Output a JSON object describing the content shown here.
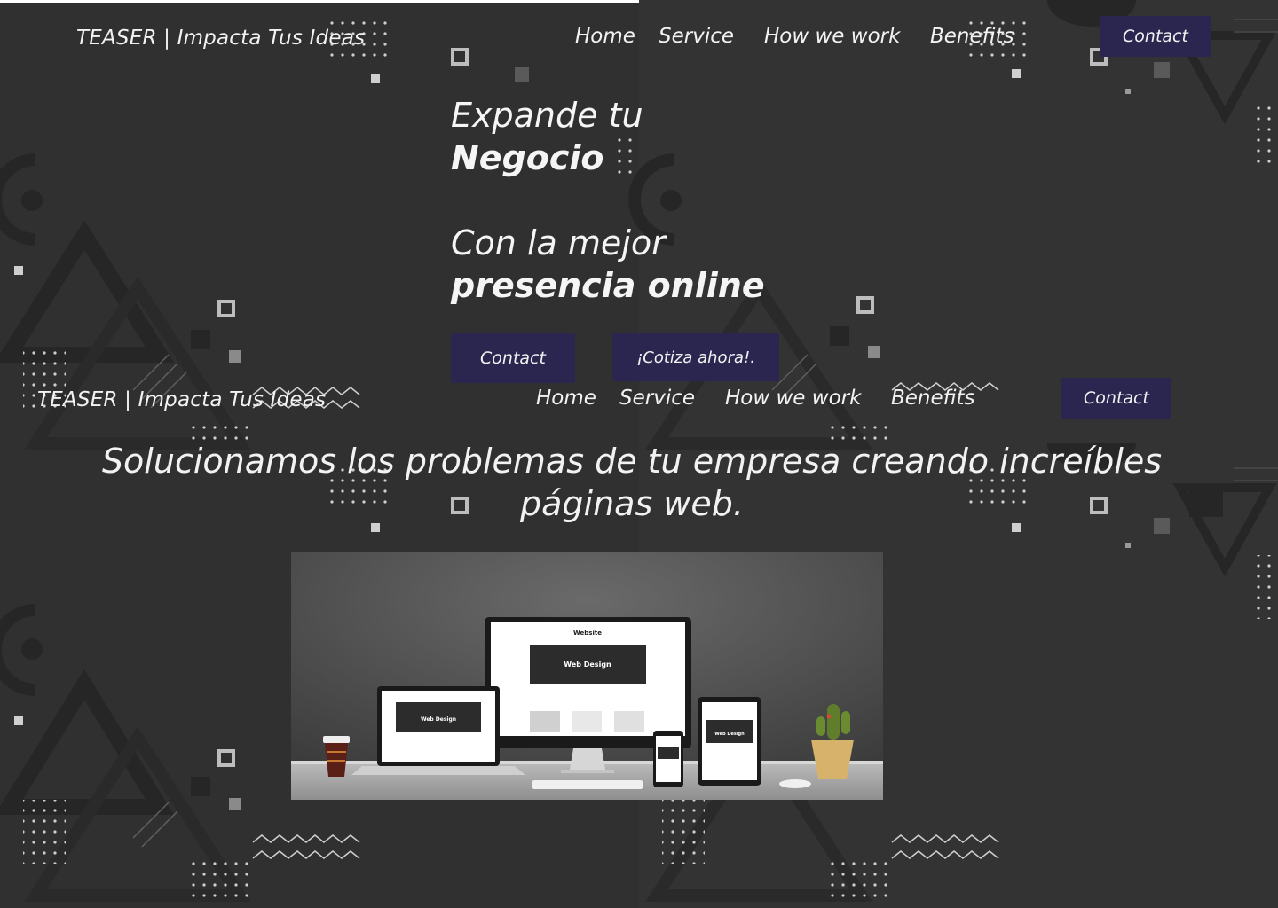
{
  "nav_top": {
    "brand": "TEASER | Impacta Tus Ideas",
    "links": [
      "Home",
      "Service",
      "How we work",
      "Benefits"
    ],
    "contact_label": "Contact"
  },
  "hero": {
    "line1": "Expande tu",
    "line2": "Negocio",
    "line3": "Con la mejor",
    "line4": "presencia online",
    "contact_button": "Contact",
    "quote_button": "¡Cotiza ahora!."
  },
  "nav_second": {
    "brand": "TEASER | Impacta Tus Ideas",
    "links": [
      "Home",
      "Service",
      "How we work",
      "Benefits"
    ],
    "contact_label": "Contact"
  },
  "tagline": "Solucionamos los problemas de tu empresa creando increíbles páginas web.",
  "mockup": {
    "monitor_brand": "Website",
    "screen_title": "Web Design"
  },
  "colors": {
    "background": "#303030",
    "accent_button": "#2a2650",
    "text": "#f2f2f2",
    "shape_dark": "#262626",
    "shape_mid": "#3b3b3b"
  }
}
